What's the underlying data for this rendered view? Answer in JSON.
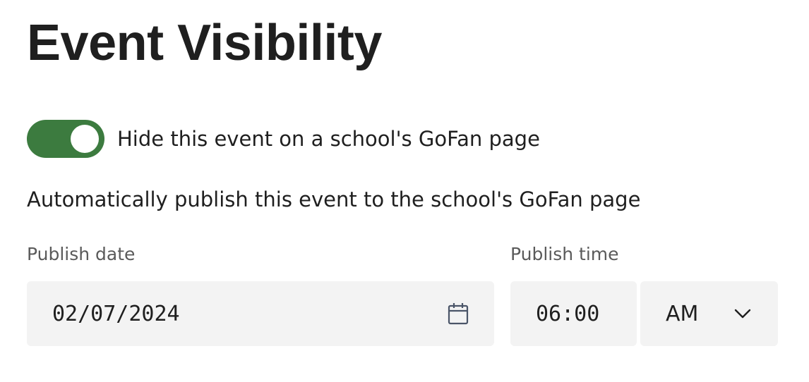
{
  "page": {
    "title": "Event Visibility"
  },
  "visibility": {
    "hide_toggle_on": true,
    "hide_label": "Hide this event on a school's GoFan page",
    "auto_publish_text": "Automatically publish this event to the school's GoFan page"
  },
  "publish": {
    "date_label": "Publish date",
    "date_value": "02/07/2024",
    "time_label": "Publish time",
    "time_value": "06:00",
    "period_value": "AM"
  },
  "colors": {
    "toggle_on": "#3c7b3f",
    "field_bg": "#f3f3f3",
    "calendar_icon": "#4a5568"
  },
  "icons": {
    "date": "calendar-icon",
    "period": "chevron-down-icon"
  }
}
